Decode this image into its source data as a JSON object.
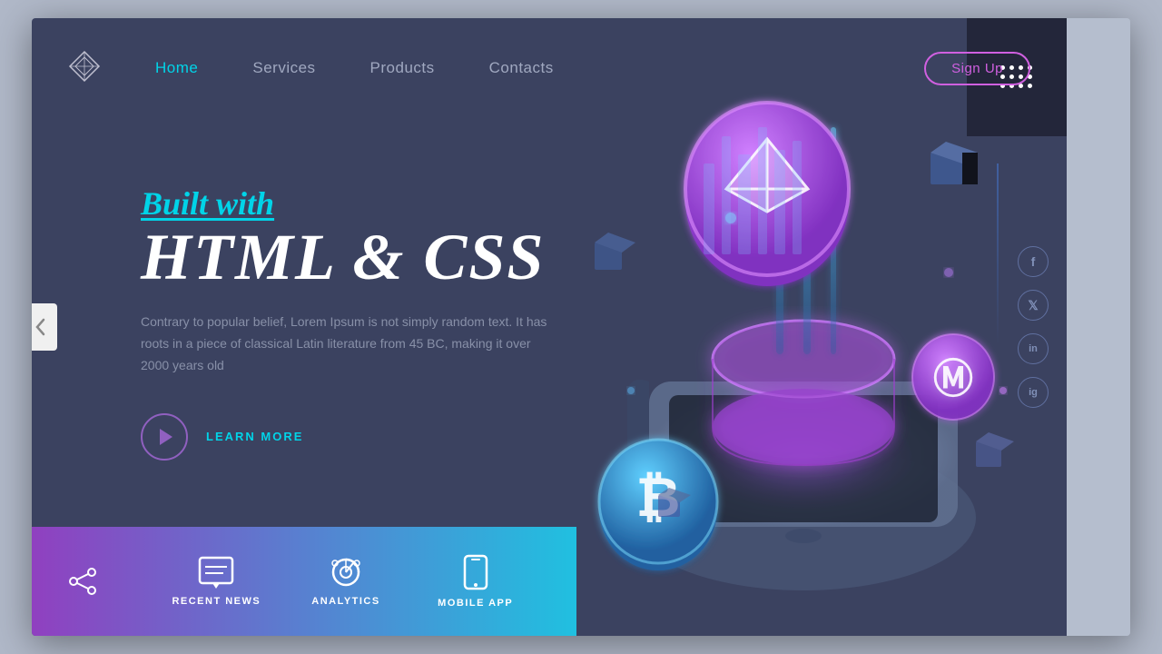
{
  "nav": {
    "logo_alt": "Diamond Logo",
    "links": [
      {
        "label": "Home",
        "active": true
      },
      {
        "label": "Services",
        "active": false
      },
      {
        "label": "Products",
        "active": false
      },
      {
        "label": "Contacts",
        "active": false
      }
    ],
    "signup_label": "Sign Up"
  },
  "hero": {
    "subtitle": "Built with",
    "title": "HTML & CSS",
    "description": "Contrary to popular belief, Lorem Ipsum is not simply random text. It has roots in a piece of classical Latin literature from 45 BC, making it over 2000 years old",
    "cta_label": "LEARN MORE"
  },
  "bottom_bar": {
    "items": [
      {
        "label": "RECENT NEWS",
        "icon": "chat-icon"
      },
      {
        "label": "ANALYTICS",
        "icon": "gear-icon"
      },
      {
        "label": "MOBILE APP",
        "icon": "mobile-icon"
      }
    ]
  },
  "social": {
    "items": [
      {
        "label": "f",
        "name": "facebook-icon"
      },
      {
        "label": "t",
        "name": "twitter-icon"
      },
      {
        "label": "in",
        "name": "linkedin-icon"
      },
      {
        "label": "ig",
        "name": "instagram-icon"
      }
    ]
  },
  "colors": {
    "accent_cyan": "#00d4e8",
    "accent_purple": "#d060e0",
    "accent_blue": "#6060c0",
    "dark_bg": "#3b4260",
    "darker_bg": "#23263a"
  }
}
